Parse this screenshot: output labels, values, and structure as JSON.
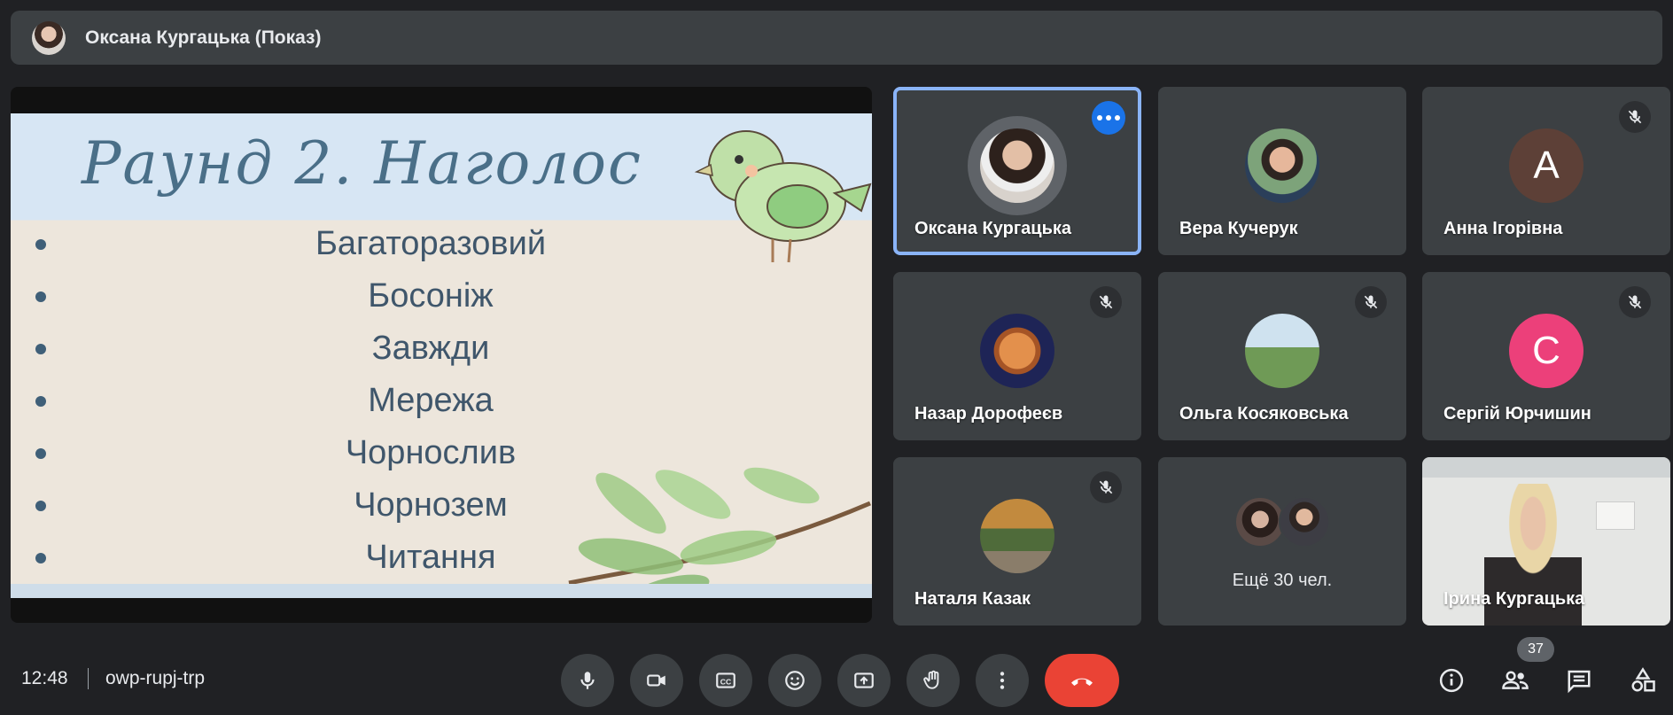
{
  "topbar": {
    "presenter_title": "Оксана Кургацька (Показ)"
  },
  "slide": {
    "title": "Раунд 2. Наголос",
    "words": [
      "Багаторазовий",
      "Босоніж",
      "Завжди",
      "Мережа",
      "Чорнослив",
      "Чорнозем",
      "Читання"
    ]
  },
  "tiles": [
    {
      "name": "Оксана Кургацька"
    },
    {
      "name": "Вера Кучерук"
    },
    {
      "name": "Анна Ігорівна",
      "letter": "A",
      "color": "#5d4037"
    },
    {
      "name": "Назар Дорофеєв"
    },
    {
      "name": "Ольга Косяковська"
    },
    {
      "name": "Сергій Юрчишин",
      "letter": "C",
      "color": "#ec407a"
    },
    {
      "name": "Наталя Казак"
    },
    {
      "others_label": "Ещё 30 чел."
    },
    {
      "name": "Ірина Кургацька"
    }
  ],
  "bottombar": {
    "time": "12:48",
    "meeting_code": "owp-rupj-trp",
    "participants_count": "37"
  },
  "icons": {
    "mic": "mic-icon",
    "camera": "camera-icon",
    "captions": "captions-icon",
    "emoji": "emoji-icon",
    "present": "present-icon",
    "hand": "raise-hand-icon",
    "more": "more-options-icon",
    "hangup": "hangup-icon",
    "info": "info-icon",
    "people": "people-icon",
    "chat": "chat-icon",
    "activities": "activities-icon"
  },
  "colors": {
    "accent": "#8ab4f8",
    "hangup": "#ea4335",
    "tile_bg": "#3c4043",
    "bg": "#202124"
  }
}
